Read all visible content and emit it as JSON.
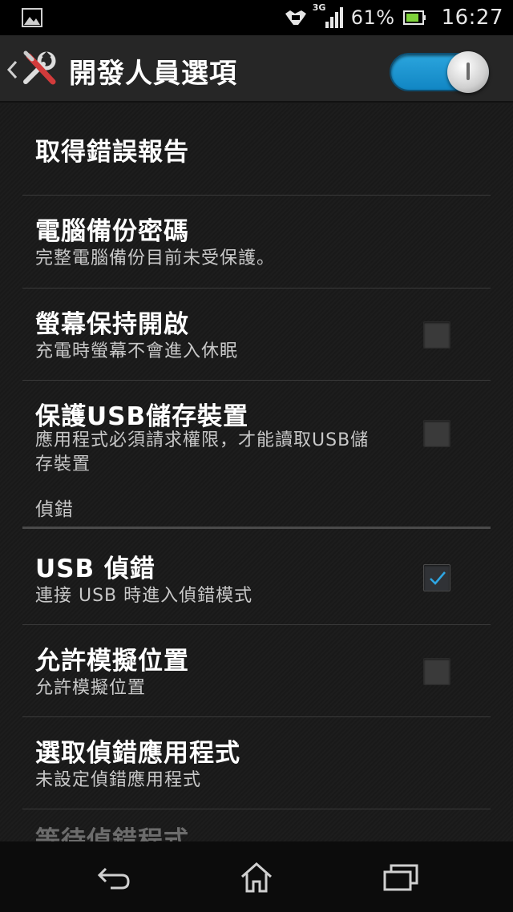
{
  "status_bar": {
    "network": "3G",
    "battery_percent": "61%",
    "time": "16:27",
    "icons": [
      "picture-icon",
      "handshake-icon",
      "signal-icon",
      "battery-icon"
    ]
  },
  "action_bar": {
    "title": "開發人員選項",
    "toggle_on": true,
    "accent": "#1a9ad6"
  },
  "items": [
    {
      "title": "取得錯誤報告",
      "summary": "",
      "checkbox": null
    },
    {
      "title": "電腦備份密碼",
      "summary": "完整電腦備份目前未受保護。",
      "checkbox": null
    },
    {
      "title": "螢幕保持開啟",
      "summary": "充電時螢幕不會進入休眠",
      "checkbox": false
    },
    {
      "title": "保護USB儲存裝置",
      "summary_line1": "應用程式必須請求權限，才能讀取USB儲",
      "summary_line2": "存裝置",
      "checkbox": false
    },
    {
      "title": "USB 偵錯",
      "summary": "連接 USB 時進入偵錯模式",
      "checkbox": true
    },
    {
      "title": "允許模擬位置",
      "summary": "允許模擬位置",
      "checkbox": false
    },
    {
      "title": "選取偵錯應用程式",
      "summary": "未設定偵錯應用程式",
      "checkbox": null
    },
    {
      "title": "等待偵錯程式",
      "summary": "",
      "checkbox": null
    }
  ],
  "category": {
    "label": "偵錯"
  },
  "nav_bar": {
    "buttons": [
      "back-icon",
      "home-icon",
      "recent-apps-icon"
    ]
  }
}
